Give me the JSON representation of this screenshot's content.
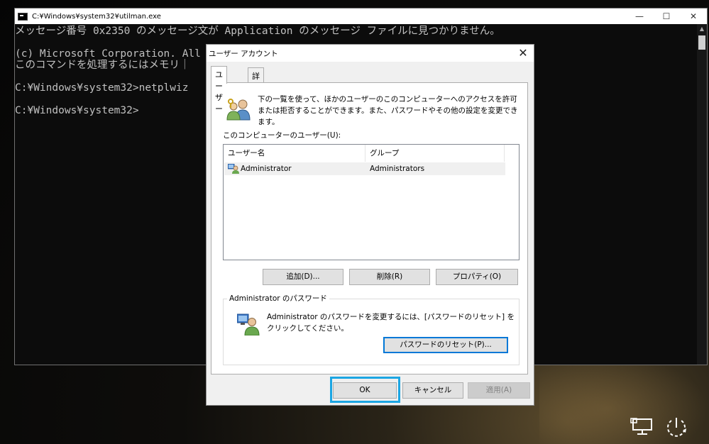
{
  "console": {
    "title": "C:¥Windows¥system32¥utilman.exe",
    "lines": [
      "メッセージ番号 0x2350 のメッセージ文が Application のメッセージ ファイルに見つかりません。",
      "",
      "(c) Microsoft Corporation. All rig",
      "このコマンドを処理するにはメモリ｜",
      "",
      "C:¥Windows¥system32>netplwiz",
      "",
      "C:¥Windows¥system32>"
    ],
    "minimize_glyph": "—",
    "maximize_glyph": "☐",
    "close_glyph": "✕"
  },
  "dialog": {
    "title": "ユーザー アカウント",
    "close_glyph": "✕",
    "tabs": [
      "ユーザー",
      "詳細設定"
    ],
    "intro": "下の一覧を使って、ほかのユーザーのこのコンピューターへのアクセスを許可または拒否することができます。また、パスワードやその他の設定を変更できます。",
    "users_label": "このコンピューターのユーザー(U):",
    "columns": [
      "ユーザー名",
      "グループ"
    ],
    "rows": [
      {
        "name": "Administrator",
        "group": "Administrators"
      }
    ],
    "buttons": {
      "add": "追加(D)...",
      "remove": "削除(R)",
      "properties": "プロパティ(O)",
      "reset_password": "パスワードのリセット(P)...",
      "ok": "OK",
      "cancel": "キャンセル",
      "apply": "適用(A)"
    },
    "password_group_title": "Administrator のパスワード",
    "password_text": "Administrator のパスワードを変更するには、[パスワードのリセット] をクリックしてください。"
  },
  "colors": {
    "highlight": "#1ca6e3",
    "focus": "#0078d7"
  },
  "tray": {
    "icons": [
      "network-icon",
      "ease-of-access-power-icon"
    ]
  }
}
